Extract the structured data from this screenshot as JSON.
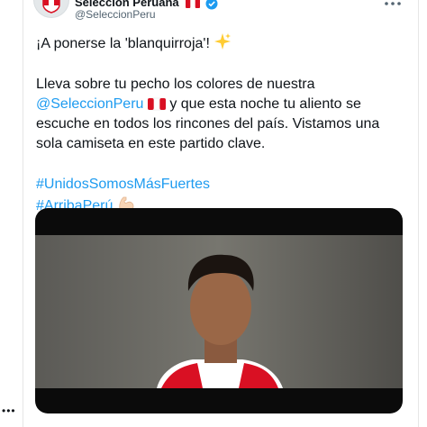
{
  "tweet": {
    "author": {
      "display_name": "Selección Peruana",
      "handle": "@SeleccionPeru"
    },
    "line1": "¡A ponerse la 'blanquirroja'!",
    "line2_pre": "Lleva sobre tu pecho los colores de nuestra",
    "mention": "@SeleccionPeru",
    "line2_post": " y que esta noche tu aliento se escuche en todos los rincones del país. Vistamos una sola camiseta en este partido clave.",
    "hashtag1": "#UnidosSomosMásFuertes",
    "hashtag2": "#ArribaPerú"
  },
  "icons": [
    "shield-icon",
    "peru-flag-icon",
    "verified-badge-icon",
    "more-icon",
    "sparkles-icon",
    "flexed-biceps-icon"
  ],
  "colors": {
    "link": "#1d9bf0",
    "text": "#0f1419",
    "secondary": "#536471",
    "peru_red": "#d91023"
  }
}
